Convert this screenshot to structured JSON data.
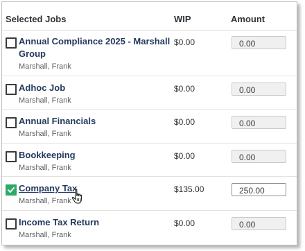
{
  "header": {
    "jobs_label": "Selected Jobs",
    "wip_label": "WIP",
    "amount_label": "Amount"
  },
  "jobs": [
    {
      "name_line1": "Annual Compliance 2025 - Marshall",
      "name_line2": "Group",
      "client": "Marshall, Frank",
      "wip": "$0.00",
      "amount": "0.00",
      "checked": false
    },
    {
      "name_line1": "Adhoc Job",
      "client": "Marshall, Frank",
      "wip": "$0.00",
      "amount": "0.00",
      "checked": false
    },
    {
      "name_line1": "Annual Financials",
      "client": "Marshall, Frank",
      "wip": "$0.00",
      "amount": "0.00",
      "checked": false
    },
    {
      "name_line1": "Bookkeeping",
      "client": "Marshall, Frank",
      "wip": "$0.00",
      "amount": "0.00",
      "checked": false
    },
    {
      "name_line1": "Company Tax",
      "client": "Marshall, Frank",
      "wip": "$135.00",
      "amount": "250.00",
      "checked": true
    },
    {
      "name_line1": "Income Tax Return",
      "client": "Marshall, Frank",
      "wip": "$0.00",
      "amount": "0.00",
      "checked": false
    }
  ],
  "colors": {
    "checked_accent": "#2eaa66",
    "job_link": "#243a5e"
  },
  "cursor_icon": "hand-pointer-icon"
}
